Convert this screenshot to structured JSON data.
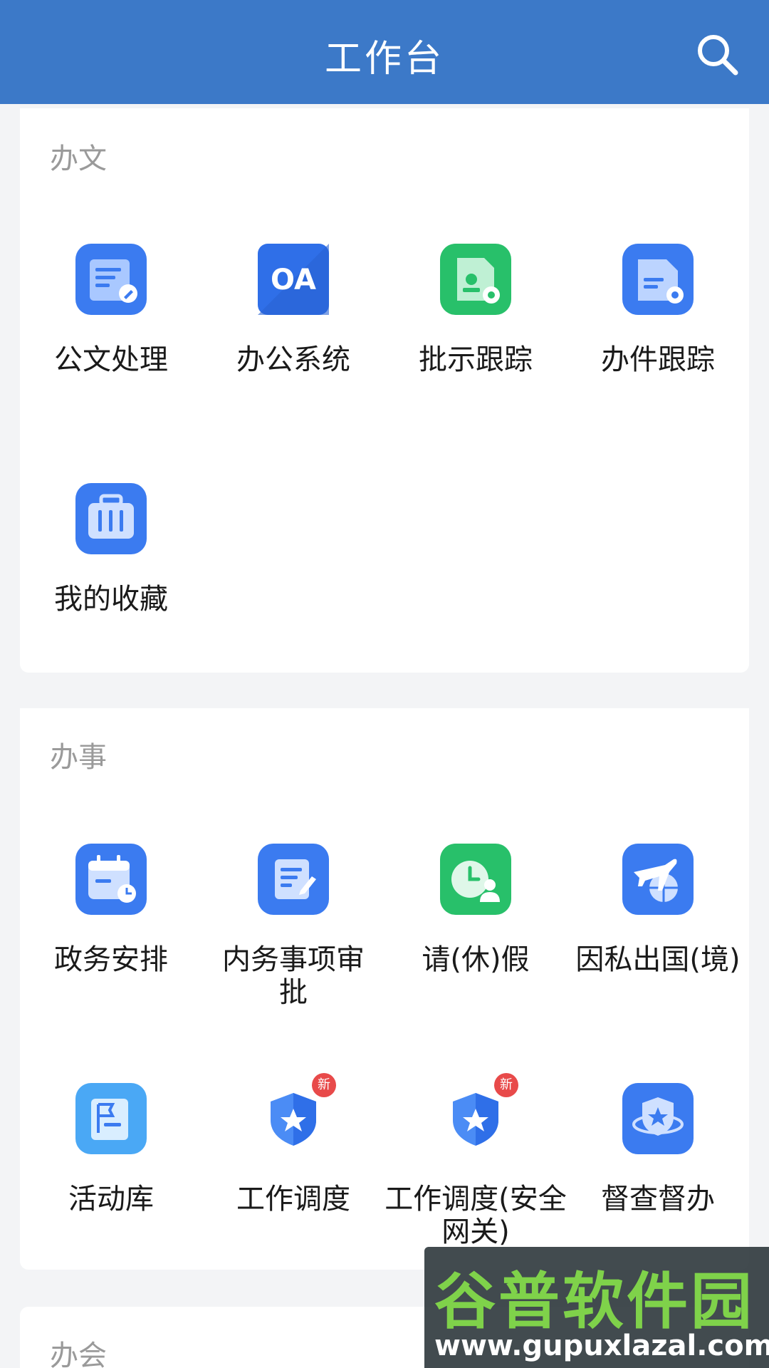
{
  "header": {
    "title": "工作台"
  },
  "sections": [
    {
      "title": "办文",
      "items": [
        {
          "label": "公文处理",
          "icon": "document-edit-icon"
        },
        {
          "label": "办公系统",
          "icon": "oa-icon",
          "icon_text": "OA"
        },
        {
          "label": "批示跟踪",
          "icon": "approval-track-icon"
        },
        {
          "label": "办件跟踪",
          "icon": "file-track-icon"
        },
        {
          "label": "我的收藏",
          "icon": "briefcase-icon"
        }
      ]
    },
    {
      "title": "办事",
      "items": [
        {
          "label": "政务安排",
          "icon": "calendar-clock-icon"
        },
        {
          "label": "内务事项审批",
          "icon": "note-edit-icon"
        },
        {
          "label": "请(休)假",
          "icon": "clock-person-icon"
        },
        {
          "label": "因私出国(境)",
          "icon": "plane-globe-icon"
        },
        {
          "label": "活动库",
          "icon": "flag-doc-icon"
        },
        {
          "label": "工作调度",
          "icon": "shield-star-icon",
          "badge": "新"
        },
        {
          "label": "工作调度(安全网关)",
          "icon": "shield-star-icon",
          "badge": "新"
        },
        {
          "label": "督查督办",
          "icon": "badge-star-icon"
        }
      ]
    },
    {
      "title": "办会"
    }
  ],
  "watermark": {
    "title": "谷普软件园",
    "url": "www.gupuxlazal.com"
  },
  "colors": {
    "header": "#3c79c8",
    "blue_icon": "#3b7bf0",
    "green_icon": "#28c06a",
    "badge": "#e84a4a"
  }
}
